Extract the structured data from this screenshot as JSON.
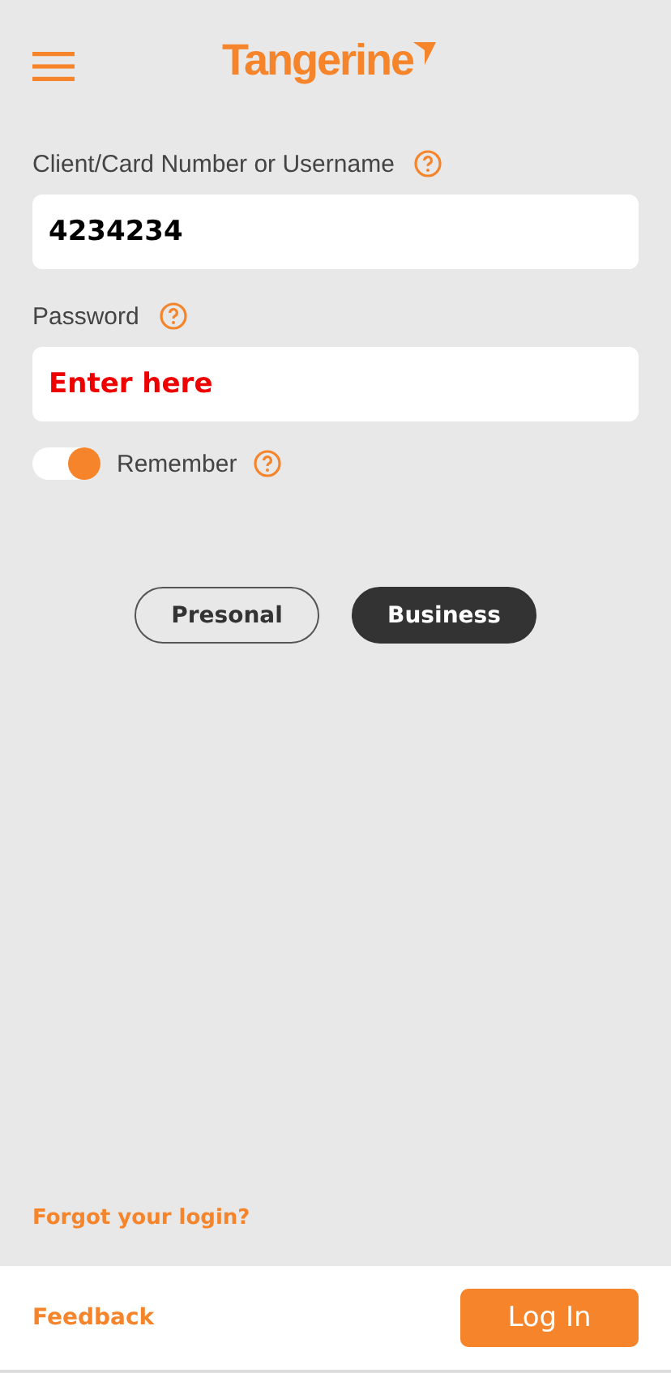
{
  "header": {
    "logo": "Tangerine"
  },
  "fields": [
    {
      "label": "Client/Card Number or Username",
      "value": "4234234"
    },
    {
      "label": "Password",
      "placeholder": "Enter here"
    }
  ],
  "remember": {
    "label": "Remember",
    "on": true
  },
  "account_types": [
    {
      "label": "Presonal",
      "selected": false
    },
    {
      "label": "Business",
      "selected": true
    }
  ],
  "forgot_link": "Forgot your login?",
  "footer": {
    "feedback": "Feedback",
    "login_button": "Log In"
  }
}
